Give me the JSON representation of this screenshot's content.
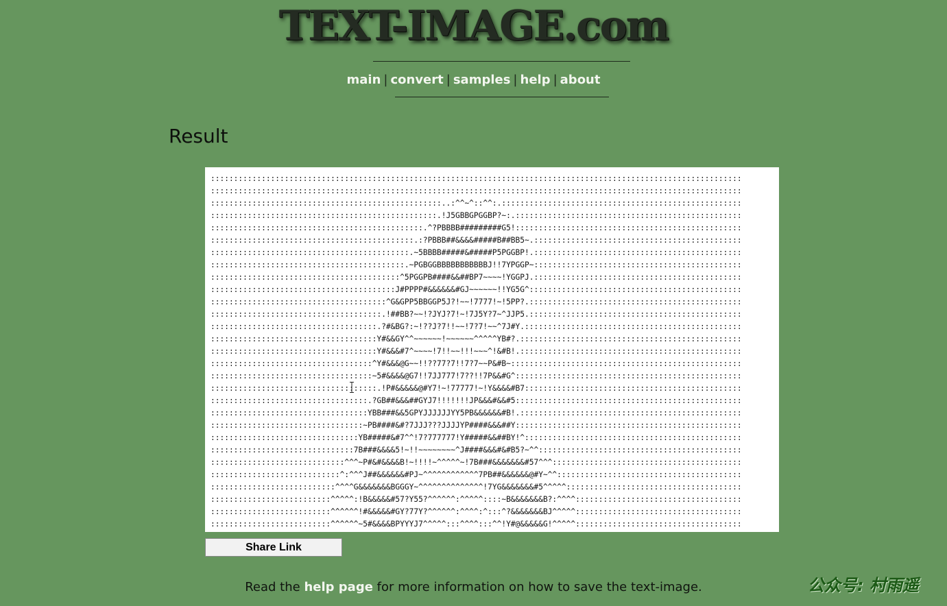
{
  "site": {
    "logo": "TEXT-IMAGE.com"
  },
  "nav": {
    "items": [
      {
        "label": "main"
      },
      {
        "label": "convert"
      },
      {
        "label": "samples"
      },
      {
        "label": "help"
      },
      {
        "label": "about"
      }
    ],
    "separator": "|"
  },
  "result": {
    "heading": "Result",
    "art_lines": [
      ":::::::::::::::::::::::::::::::::::::::::::::::::::::::::::::::::::::::::::::::::::::::::::::::::::::::::::::::::::::::::::",
      ":::::::::::::::::::::::::::::::::::::::::::::::::::::::::::::::::::::::::::::::::::::::::::::::::::::::::::::::::::::::::::",
      "::::::::::::::::::::::::::::::::::::::::::::::::::..:^^~^::^^:.:::::::::::::::::::::::::::::::::::::::::::::::::::::::::::::",
      ":::::::::::::::::::::::::::::::::::::::::::::::::.!J5GBBGPGGBP?~:.:::::::::::::::::::::::::::::::::::::::::::::::::::::::::",
      "::::::::::::::::::::::::::::::::::::::::::::::.^?PBBBB#########G5!::::::::::::::::::::::::::::::::::::::::::::::::::::::::::",
      "::::::::::::::::::::::::::::::::::::::::::::.:?PBBB##&&&&#####B##BB5~.:::::::::::::::::::::::::::::::::::::::::::::::::::::",
      ":::::::::::::::::::::::::::::::::::::::::::.~5BBBB#####&#####P5PGGBP!.::::::::::::::::::::::::::::::::::::::::::::::::::::::",
      "::::::::::::::::::::::::::::::::::::::::::.~PGBGGBBBBBBBBBBBJ!!7YPGGP~:::::::::::::::::::::::::::::::::::::::::::::::::::::::",
      ":::::::::::::::::::::::::::::::::::::::::^5PGGPB####&&##BP7~~~~!YGGPJ.::::::::::::::::::::::::::::::::::::::::::::::::::::::",
      "::::::::::::::::::::::::::::::::::::::::J#PPPP#&&&&&&#GJ~~~~~~!!YG5G^::::::::::::::::::::::::::::::::::::::::::::::::::::::::",
      "::::::::::::::::::::::::::::::::::::::^G&GPP5BBGGP5J?!~~!7777!~!5PP?.::::::::::::::::::::::::::::::::::::::::::::::::::::::::",
      ":::::::::::::::::::::::::::::::::::::.!##BB?~~!?JYJ?7!~!7J5Y?7~^JJP5.::::::::::::::::::::::::::::::::::::::::::::::::::::::::",
      "::::::::::::::::::::::::::::::::::::.?#&BG?:~!??J?7!!~~!7?7!~~^7J#Y.:::::::::::::::::::::::::::::::::::::::::::::::::::::::::",
      "::::::::::::::::::::::::::::::::::::Y#&&GY^^~~~~~~!~~~~~~^^^^^YB#?.::::::::::::::::::::::::::::::::::::::::::::::::::::::::",
      "::::::::::::::::::::::::::::::::::::Y#&&&#7^~~~~!7!!~~!!!~~~^!&#B!.::::::::::::::::::::::::::::::::::::::::::::::::::::::::",
      ":::::::::::::::::::::::::::::::::::^Y#&&&@G~~!!??77?7!!7?7~~P&#B~::::::::::::::::::::::::::::::::::::::::::::::::::::::::::",
      ":::::::::::::::::::::::::::::::::::~5#&&&&@G7!!7JJ777!7??!!7P&&#G^:::::::::::::::::::::::::::::::::::::::::::::::::::::::::",
      "::::::::::::::::::::::::::::::::::::.!P#&&&&&@#Y7!~!77777!~!Y&&&&#B7:::::::::::::::::::::::::::::::::::::::::::::::::::::::",
      "::::::::::::::::::::::::::::::::::.?GB##&&&##GYJ7!!!!!!!JP&&&#&&#5:::::::::::::::::::::::::::::::::::::::::::::::::::::::::",
      "::::::::::::::::::::::::::::::::::YBB###&&5GPYJJJJJJYY5PB&&&&&&#B!.::::::::::::::::::::::::::::::::::::::::::::::::::::::::",
      ":::::::::::::::::::::::::::::::::~PB####&#?7JJJ???JJJJYP####&&&##Y::::::::::::::::::::::::::::::::::::::::::::::::::::::::::",
      "::::::::::::::::::::::::::::::::YB#####&#7^^!7?777777!Y#####&&##BY!^::::::::::::::::::::::::::::::::::::::::::::::::::::::::",
      ":::::::::::::::::::::::::::::::7B###&&&&5!~!!~~~~~~~~^J####&&&#&#B5?~^^:::::::::::::::::::::::::::::::::::::::::::::::::::",
      ":::::::::::::::::::::::::::::^^^~P#&#&&&&B!~!!!!~^^^^^~!7B###&&&&&&&#57^^^:::::::::::::::::::::::::::::::::::::::::::::::::",
      "::::::::::::::::::::::::::::^:^^^J##&&&&&&#PJ~^^^^^^^^^^^^7PB##&&&&&&@#Y~^^:::::::::::::::::::::::::::::::::::::::::::::::",
      ":::::::::::::::::::::::::::^^^^G&&&&&&&BGGGY~^^^^^^^^^^^^^^!7YG&&&&&&&#5^^^^^::::::::::::::::::::::::::::::::::::::::::::",
      "::::::::::::::::::::::::::^^^^^:!B&&&&&#57?Y55?^^^^^^:^^^^^::::~B&&&&&&&B?:^^^^::::::::::::::::::::::::::::::::::::::::::",
      "::::::::::::::::::::::::::^^^^^^!#&&&&&#GY?77Y?^^^^^^:^^^^:^:::^?&&&&&&&BJ^^^^^::::::::::::::::::::::::::::::::::::::::::",
      "::::::::::::::::::::::::::^^^^^^~5#&&&&BPYYYJ7^^^^^:::^^^^:::^^!Y#@&&&&&G!^^^^^:::::::::::::::::::::::::::::::::::::::::"
    ]
  },
  "share": {
    "button_label": "Share Link"
  },
  "footer": {
    "prefix": "Read the ",
    "link": "help page",
    "suffix": " for more information on how to save the text-image."
  },
  "watermark": {
    "text": "公众号: 村雨遥"
  },
  "colors": {
    "background": "#66965e",
    "nav_link": "#f3f6ef",
    "art_panel": "#ffffff"
  }
}
